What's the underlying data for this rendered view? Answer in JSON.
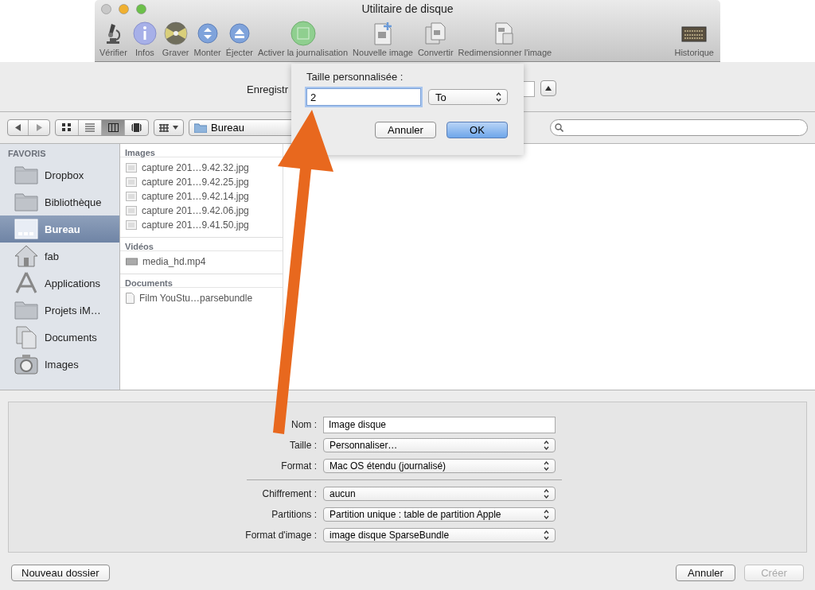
{
  "window": {
    "title": "Utilitaire de disque"
  },
  "toolbar": [
    {
      "label": "Vérifier"
    },
    {
      "label": "Infos"
    },
    {
      "label": "Graver"
    },
    {
      "label": "Monter"
    },
    {
      "label": "Éjecter"
    },
    {
      "label": "Activer la journalisation"
    },
    {
      "label": "Nouvelle image"
    },
    {
      "label": "Convertir"
    },
    {
      "label": "Redimensionner l'image"
    },
    {
      "label": "Historique"
    }
  ],
  "save_sheet": {
    "save_as_label": "Enregistr",
    "location": "Bureau",
    "view_modes": [
      {
        "selected": false
      },
      {
        "selected": false
      },
      {
        "selected": true
      },
      {
        "selected": false
      }
    ]
  },
  "custom_size_popover": {
    "label": "Taille personnalisée :",
    "value": "2",
    "unit": "To",
    "buttons": [
      {
        "label": "Annuler",
        "default": false
      },
      {
        "label": "OK",
        "default": true
      }
    ]
  },
  "sidebar": {
    "heading": "FAVORIS",
    "items": [
      {
        "label": "Dropbox",
        "selected": false
      },
      {
        "label": "Bibliothèque",
        "selected": false
      },
      {
        "label": "Bureau",
        "selected": true
      },
      {
        "label": "fab",
        "selected": false
      },
      {
        "label": "Applications",
        "selected": false
      },
      {
        "label": "Projets iM…",
        "selected": false
      },
      {
        "label": "Documents",
        "selected": false
      },
      {
        "label": "Images",
        "selected": false
      }
    ]
  },
  "column": {
    "groups": [
      {
        "heading": "Images",
        "files": [
          "capture 201…9.42.32.jpg",
          "capture 201…9.42.25.jpg",
          "capture 201…9.42.14.jpg",
          "capture 201…9.42.06.jpg",
          "capture 201…9.41.50.jpg"
        ]
      },
      {
        "heading": "Vidéos",
        "files": [
          "media_hd.mp4"
        ]
      },
      {
        "heading": "Documents",
        "files": [
          "Film YouStu…parsebundle"
        ]
      }
    ]
  },
  "option_groups": [
    [
      {
        "label": "Nom :",
        "value": "Image disque",
        "kind": "text"
      },
      {
        "label": "Taille :",
        "value": "Personnaliser…",
        "kind": "popup"
      },
      {
        "label": "Format :",
        "value": "Mac OS étendu (journalisé)",
        "kind": "popup"
      }
    ],
    [
      {
        "label": "Chiffrement :",
        "value": "aucun",
        "kind": "popup"
      },
      {
        "label": "Partitions :",
        "value": "Partition unique : table de partition Apple",
        "kind": "popup"
      },
      {
        "label": "Format d'image :",
        "value": "image disque SparseBundle",
        "kind": "popup"
      }
    ]
  ],
  "buttons": {
    "left": [
      {
        "label": "Nouveau dossier",
        "disabled": false
      }
    ],
    "right": [
      {
        "label": "Annuler",
        "disabled": false
      },
      {
        "label": "Créer",
        "disabled": true
      }
    ]
  }
}
